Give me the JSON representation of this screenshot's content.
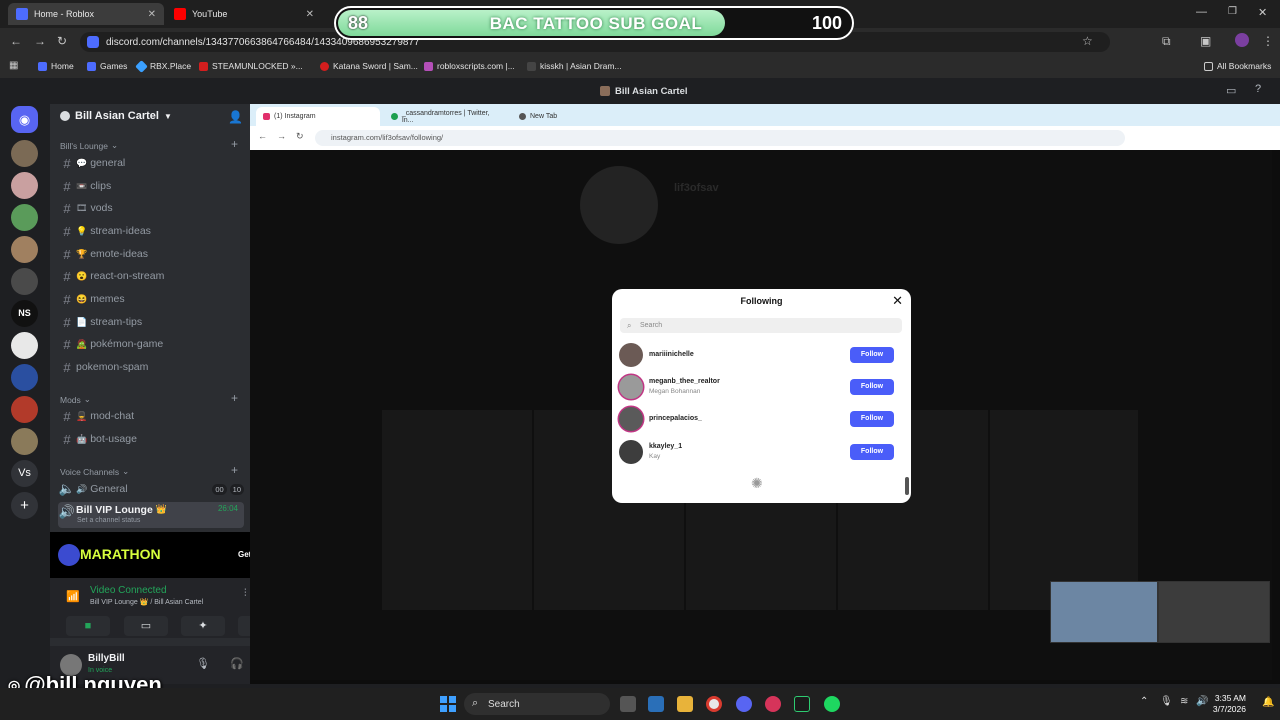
{
  "browser": {
    "tabs": [
      {
        "title": "Home - Roblox",
        "favicon_color": "#4d6cff"
      },
      {
        "title": "YouTube",
        "favicon_color": "#ff0000"
      }
    ],
    "url": "discord.com/channels/1343770663864766484/1433409686953279877",
    "bookmarks": [
      "Home",
      "Games",
      "RBX.Place",
      "STEAMUNLOCKED »...",
      "Katana Sword | Sam...",
      "robloxscripts.com |...",
      "kisskh | Asian Dram..."
    ],
    "all_bookmarks": "All Bookmarks"
  },
  "sub_goal": {
    "current": "88",
    "title": "BAC TATTOO SUB GOAL",
    "target": "100",
    "progress": 0.88
  },
  "discord": {
    "window_title": "Bill Asian Cartel",
    "server_name": "Bill Asian Cartel",
    "categories": {
      "lounge": "Bill's Lounge",
      "mods": "Mods",
      "voice": "Voice Channels"
    },
    "channels": [
      {
        "name": "general",
        "emoji": "💬"
      },
      {
        "name": "clips",
        "emoji": "📼"
      },
      {
        "name": "vods",
        "emoji": "🎞"
      },
      {
        "name": "stream-ideas",
        "emoji": "💡"
      },
      {
        "name": "emote-ideas",
        "emoji": "🏆"
      },
      {
        "name": "react-on-stream",
        "emoji": "😮"
      },
      {
        "name": "memes",
        "emoji": "😆"
      },
      {
        "name": "stream-tips",
        "emoji": "📄"
      },
      {
        "name": "pokémon-game",
        "emoji": "🧟"
      },
      {
        "name": "pokemon-spam",
        "emoji": ""
      }
    ],
    "mod_channels": [
      {
        "name": "mod-chat",
        "emoji": "💂"
      },
      {
        "name": "bot-usage",
        "emoji": "🤖"
      }
    ],
    "voice_channels": [
      {
        "name": "General",
        "emoji": "🔊",
        "count_a": "00",
        "count_b": "10"
      },
      {
        "name": "Bill VIP Lounge",
        "emoji": "👑",
        "timer": "26:04",
        "status": "Set a channel status"
      }
    ],
    "promo": {
      "title": "MARATHON",
      "cta": "Get Reward!"
    },
    "voice_status": {
      "label": "Video Connected",
      "location": "Bill VIP Lounge 👑 / Bill Asian Cartel"
    },
    "user": {
      "name": "BillyBill",
      "status": "In voice"
    },
    "rail_labels": {
      "ns": "NS",
      "vs": "Vs"
    }
  },
  "stream": {
    "tabs": [
      "(1) Instagram",
      "_cassandramtorres | Twitter, In...",
      "New Tab"
    ],
    "url": "instagram.com/lif3ofsav/following/",
    "profile_name": "lif3ofsav",
    "modal": {
      "title": "Following",
      "search_placeholder": "Search",
      "follow_label": "Follow",
      "users": [
        {
          "username": "mariiinichelle",
          "name": ""
        },
        {
          "username": "meganb_thee_realtor",
          "name": "Megan Bohannan"
        },
        {
          "username": "princepalacios_",
          "name": ""
        },
        {
          "username": "kkayley_1",
          "name": "Kay"
        }
      ]
    }
  },
  "overlay_handle": "@bill.nguyen",
  "taskbar": {
    "search": "Search",
    "time": "3:35 AM",
    "date": "3/7/2026"
  }
}
